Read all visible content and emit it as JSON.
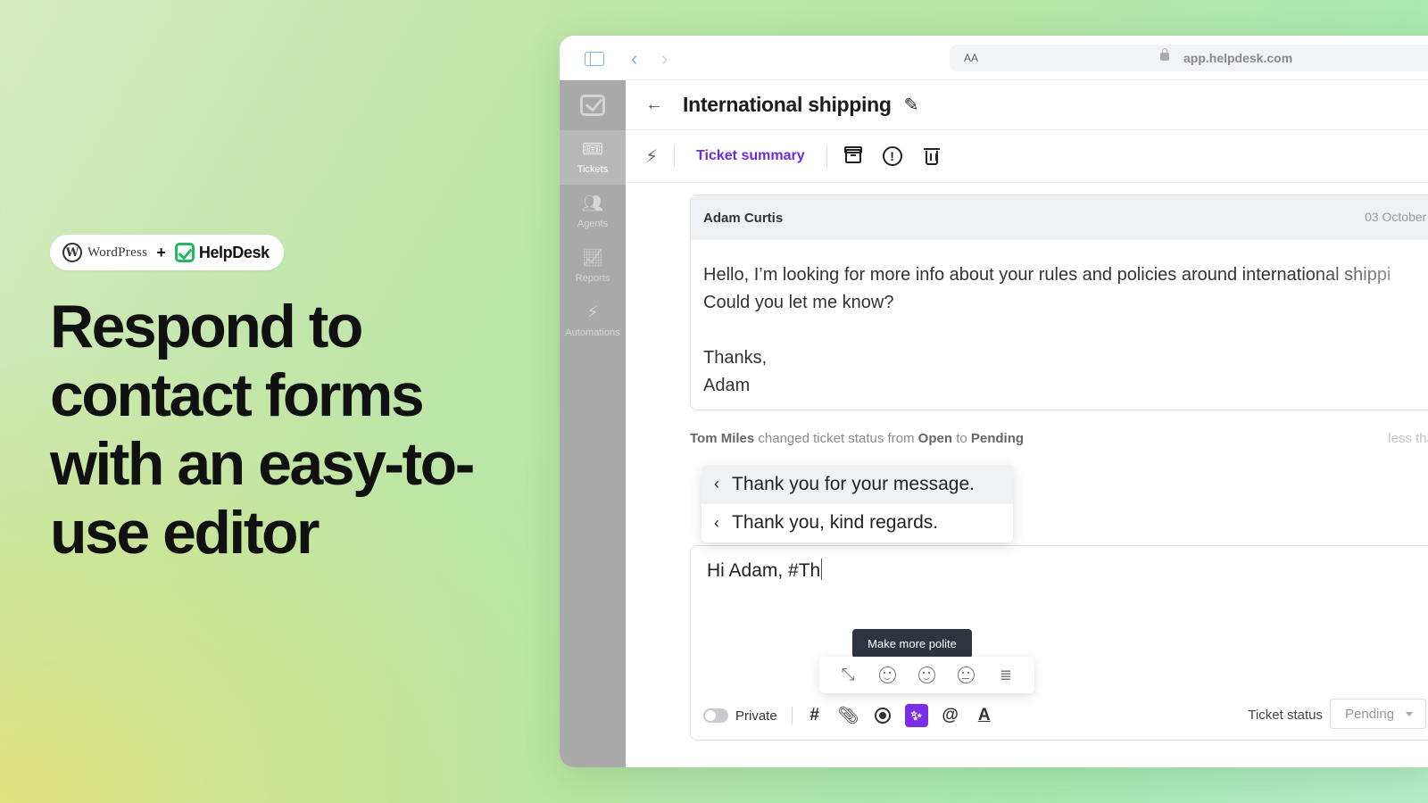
{
  "promo": {
    "wordpress_logo": "WordPress",
    "plus": "+",
    "helpdesk_logo": "HelpDesk",
    "headline": "Respond to contact forms with an easy-to-use editor"
  },
  "browser": {
    "text_size": "AA",
    "url": "app.helpdesk.com"
  },
  "sidebar": {
    "items": [
      {
        "label": "Tickets",
        "icon": "ticket-icon",
        "active": true
      },
      {
        "label": "Agents",
        "icon": "agents-icon",
        "active": false
      },
      {
        "label": "Reports",
        "icon": "reports-icon",
        "active": false
      },
      {
        "label": "Automations",
        "icon": "automations-icon",
        "active": false
      }
    ]
  },
  "ticket": {
    "title": "International shipping",
    "summary_link": "Ticket summary"
  },
  "message": {
    "author": "Adam Curtis",
    "date": "03 October 2",
    "body": "Hello, I’m looking for more info about your rules and policies around international shippi\nCould you let me know?\n\nThanks,\nAdam"
  },
  "status_change": {
    "actor": "Tom Miles",
    "text": "changed ticket status from",
    "from": "Open",
    "to_word": "to",
    "to": "Pending",
    "time": "less tha"
  },
  "snippets": [
    {
      "text": "Thank you for your message.",
      "selected": true
    },
    {
      "text": "Thank you, kind regards.",
      "selected": false
    }
  ],
  "composer": {
    "text": "Hi Adam, #Th",
    "tooltip": "Make more polite",
    "private_label": "Private",
    "status_label": "Ticket status",
    "status_value": "Pending"
  },
  "colors": {
    "accent": "#7a2fe6",
    "link": "#6a2be2",
    "brand_green": "#1fb863"
  }
}
